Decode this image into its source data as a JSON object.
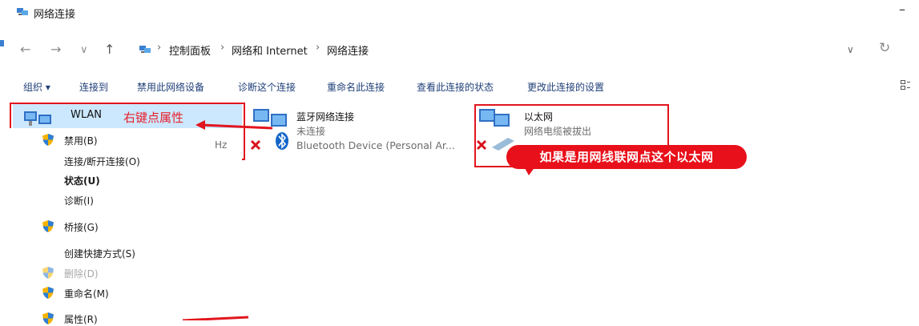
{
  "window": {
    "title": "网络连接"
  },
  "nav": {
    "back": "←",
    "forward": "→",
    "recent": "∨",
    "up": "↑"
  },
  "breadcrumb": [
    {
      "label": "控制面板"
    },
    {
      "label": "网络和 Internet"
    },
    {
      "label": "网络连接"
    }
  ],
  "command_bar": [
    {
      "label": "组织 ▾"
    },
    {
      "label": "连接到"
    },
    {
      "label": "禁用此网络设备"
    },
    {
      "label": "诊断这个连接"
    },
    {
      "label": "重命名此连接"
    },
    {
      "label": "查看此连接的状态"
    },
    {
      "label": "更改此连接的设置"
    }
  ],
  "items": [
    {
      "name": "WLAN",
      "sub1": "",
      "sub2": "Hz"
    },
    {
      "name": "蓝牙网络连接",
      "sub1": "未连接",
      "sub2": "Bluetooth Device (Personal Ar..."
    },
    {
      "name": "以太网",
      "sub1": "网络电缆被拔出",
      "sub2": ""
    }
  ],
  "annotations": {
    "right_click": "右键点属性",
    "ethernet_note": "如果是用网线联网点这个以太网"
  },
  "context_menu": [
    {
      "label": "禁用(B)",
      "shield": true,
      "style": "normal"
    },
    {
      "label": "连接/断开连接(O)",
      "shield": false,
      "style": "normal"
    },
    {
      "label": "状态(U)",
      "shield": false,
      "style": "bold"
    },
    {
      "label": "诊断(I)",
      "shield": false,
      "style": "normal"
    },
    {
      "label": "桥接(G)",
      "shield": true,
      "style": "normal"
    },
    {
      "label": "创建快捷方式(S)",
      "shield": false,
      "style": "normal"
    },
    {
      "label": "删除(D)",
      "shield": true,
      "style": "disabled"
    },
    {
      "label": "重命名(M)",
      "shield": true,
      "style": "normal"
    },
    {
      "label": "属性(R)",
      "shield": true,
      "style": "normal"
    }
  ],
  "colors": {
    "selection": "#cce8ff",
    "annotation_red": "#e2151d",
    "link_blue": "#1f3f78"
  }
}
